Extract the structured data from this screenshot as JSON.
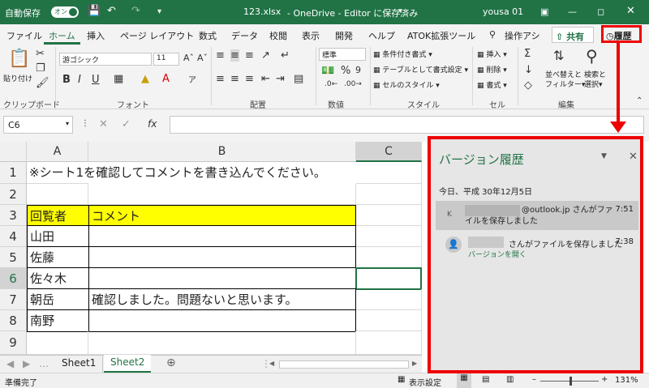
{
  "titlebar": {
    "autosave_label": "自動保存",
    "autosave_state": "オン",
    "filename": "123.xlsx",
    "title_rest": "- OneDrive - Editor に保存済み",
    "user": "yousa 01"
  },
  "tabs": [
    "ファイル",
    "ホーム",
    "挿入",
    "ページ レイアウト",
    "数式",
    "データ",
    "校閲",
    "表示",
    "開発",
    "ヘルプ",
    "ATOK拡張ツール",
    "操作アシ"
  ],
  "share_label": "共有",
  "history_label": "履歴",
  "ribbon": {
    "clipboard": {
      "paste": "貼り付け",
      "group": "クリップボード"
    },
    "font": {
      "name": "游ゴシック",
      "size": "11",
      "group": "フォント"
    },
    "alignment": {
      "group": "配置"
    },
    "number": {
      "format": "標準",
      "group": "数値"
    },
    "styles": {
      "conditional": "条件付き書式",
      "table": "テーブルとして書式設定",
      "cell": "セルのスタイル",
      "group": "スタイル"
    },
    "cells": {
      "insert": "挿入",
      "delete": "削除",
      "format": "書式",
      "group": "セル"
    },
    "editing": {
      "sort": "並べ替えと",
      "filter": "フィルター",
      "find": "検索と",
      "select": "選択",
      "group": "編集"
    }
  },
  "namebox": "C6",
  "fx": "fx",
  "columns": [
    "A",
    "B",
    "C"
  ],
  "rows": [
    "1",
    "2",
    "3",
    "4",
    "5",
    "6",
    "7",
    "8",
    "9"
  ],
  "cells": {
    "a1": "※シート1を確認してコメントを書き込んでください。",
    "a3": "回覧者",
    "b3": "コメント",
    "a4": "山田",
    "a5": "佐藤",
    "a6": "佐々木",
    "a7": "朝岳",
    "b7": "確認しました。問題ないと思います。",
    "a8": "南野"
  },
  "sheets": [
    "Sheet1",
    "Sheet2"
  ],
  "status": {
    "ready": "準備完了",
    "display": "表示設定",
    "zoom": "131%"
  },
  "version_pane": {
    "title": "バージョン履歴",
    "date_header": "今日、平成 30年12月5日",
    "items": [
      {
        "avatar": "K",
        "text": "@outlook.jp さんがファイルを保存しました",
        "time": "7:51"
      },
      {
        "text": "さんがファイルを保存しました",
        "time": "7:38",
        "link": "バージョンを開く"
      }
    ]
  },
  "colors": {
    "excel_green": "#217346",
    "highlight_red": "#e00000",
    "yellow": "#ffff00"
  }
}
